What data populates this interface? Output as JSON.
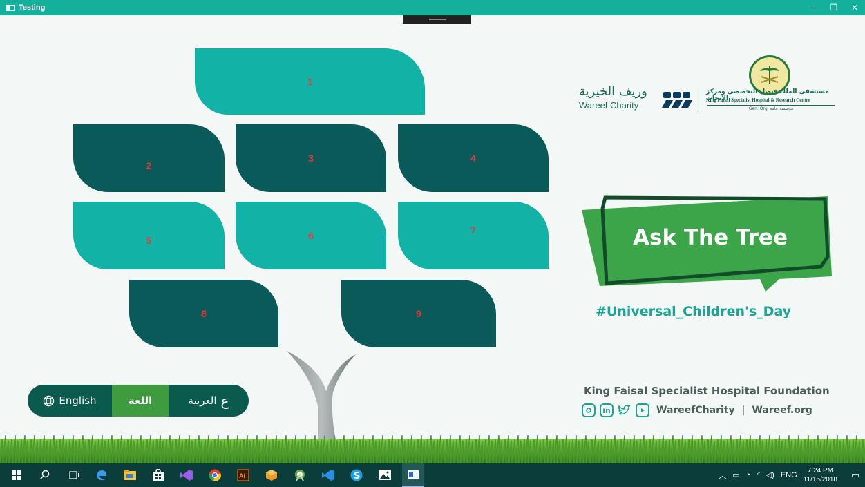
{
  "window": {
    "title": "Testing",
    "controls": {
      "minimize": "—",
      "maximize": "❐",
      "close": "✕"
    }
  },
  "tree": {
    "leaves": [
      {
        "label": "1",
        "color": "teal"
      },
      {
        "label": "2",
        "color": "dark"
      },
      {
        "label": "3",
        "color": "dark"
      },
      {
        "label": "4",
        "color": "dark"
      },
      {
        "label": "5",
        "color": "teal"
      },
      {
        "label": "6",
        "color": "teal"
      },
      {
        "label": "7",
        "color": "teal"
      },
      {
        "label": "8",
        "color": "dark"
      },
      {
        "label": "9",
        "color": "dark"
      }
    ],
    "number_color": "#e23a3a",
    "teal": "#13b2a6",
    "dark": "#0b5a5a"
  },
  "branding": {
    "wareef_ar": "وريف الخيرية",
    "wareef_en": "Wareef Charity",
    "kfsh_ar": "مستشفى الملك فيصل التخصصي ومركز الأبحاث",
    "kfsh_en": "King Faisal Specialist Hospital & Research Centre",
    "kfsh_org": "Gen. Org. مؤسسة عامة",
    "ask_title": "Ask The Tree",
    "hashtag": "#Universal_Children's_Day",
    "foundation": "King Faisal Specialist Hospital Foundation",
    "social_handle": "WareefCharity",
    "social_sep": "|",
    "website": "Wareef.org",
    "social_icons": [
      "instagram-icon",
      "linkedin-icon",
      "twitter-icon",
      "youtube-icon"
    ]
  },
  "language": {
    "english": "English",
    "label": "اللغة",
    "arabic": "العربية",
    "arabic_glyph": "ع"
  },
  "taskbar": {
    "apps": [
      "start",
      "search",
      "task-view",
      "edge",
      "file-explorer",
      "store",
      "visual-studio",
      "chrome",
      "illustrator",
      "package",
      "android-studio",
      "vs-code",
      "skype",
      "photos",
      "testing-app"
    ],
    "tray": {
      "language": "ENG",
      "time": "7:24 PM",
      "date": "11/15/2018"
    }
  }
}
